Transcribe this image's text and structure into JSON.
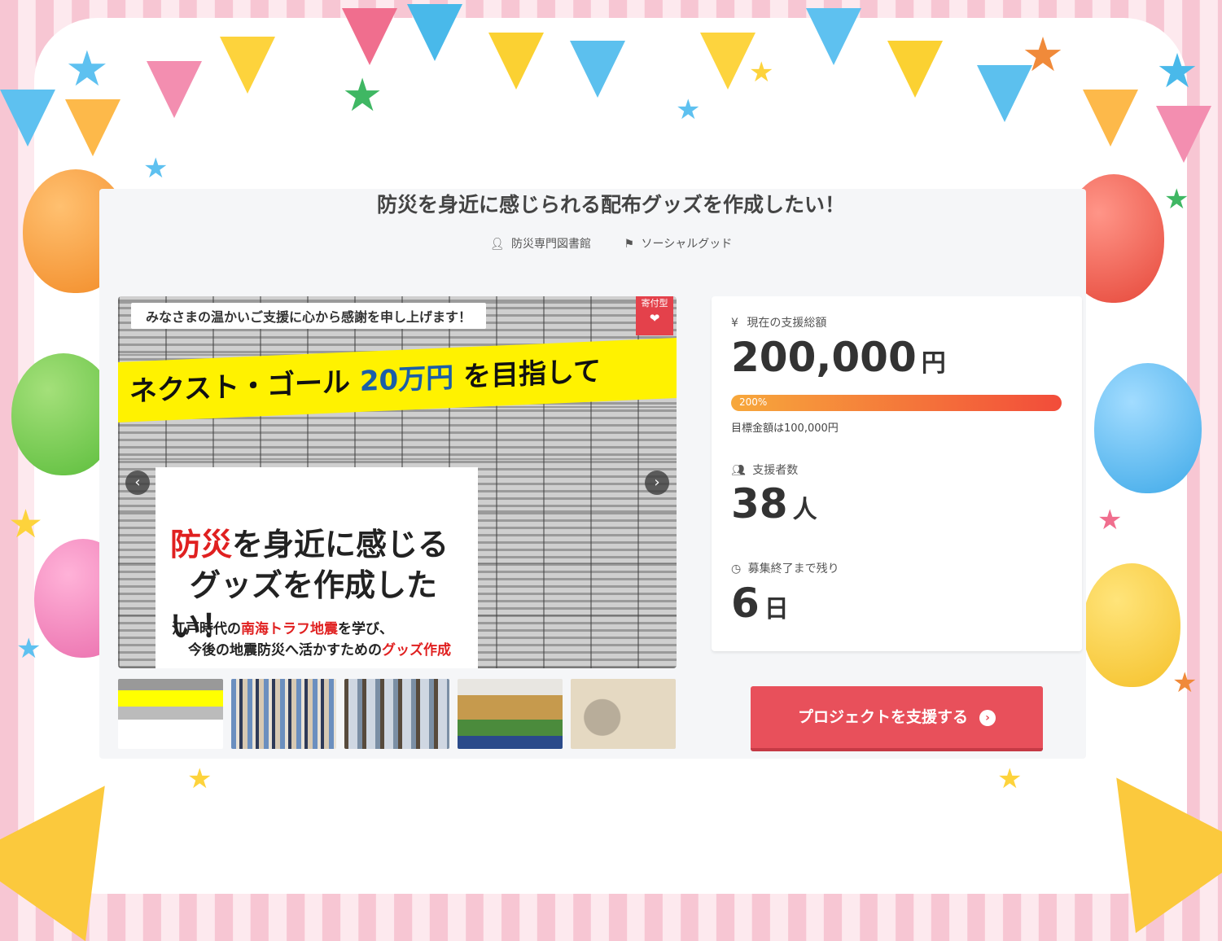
{
  "project": {
    "title": "防災を身近に感じられる配布グッズを作成したい！",
    "owner": "防災専門図書館",
    "category": "ソーシャルグッド"
  },
  "image": {
    "thanks_text": "みなさまの温かいご支援に心から感謝を申し上げます！",
    "type_tag": "寄付型",
    "banner_pre": "ネクスト・ゴール ",
    "banner_amount": "20万円",
    "banner_post": " を目指して",
    "headline_red": "防災",
    "headline_line1_rest": "を身近に感じる",
    "headline_line2": "グッズを作成したい！",
    "sub_line1_pre": "江戸時代の",
    "sub_line1_red": "南海トラフ地震",
    "sub_line1_post": "を学び、",
    "sub_line2_pre": "今後の地震防災へ活かすための",
    "sub_line2_red": "グッズ作成"
  },
  "stats": {
    "total_label": "現在の支援総額",
    "total_value": "200,000",
    "total_unit": "円",
    "progress_percent": 200,
    "progress_text": "200%",
    "goal_text": "目標金額は100,000円",
    "supporters_label": "支援者数",
    "supporters_value": "38",
    "supporters_unit": "人",
    "remaining_label": "募集終了まで残り",
    "remaining_value": "6",
    "remaining_unit": "日"
  },
  "cta": {
    "label": "プロジェクトを支援する"
  },
  "icons": {
    "owner": "user-icon",
    "category": "tag-icon",
    "total": "yen-icon",
    "supporters": "users-icon",
    "remaining": "clock-icon",
    "cta": "chevron-right-icon"
  },
  "colors": {
    "accent": "#e8505b",
    "bar_start": "#f7a83b",
    "bar_end": "#f24c3a"
  }
}
